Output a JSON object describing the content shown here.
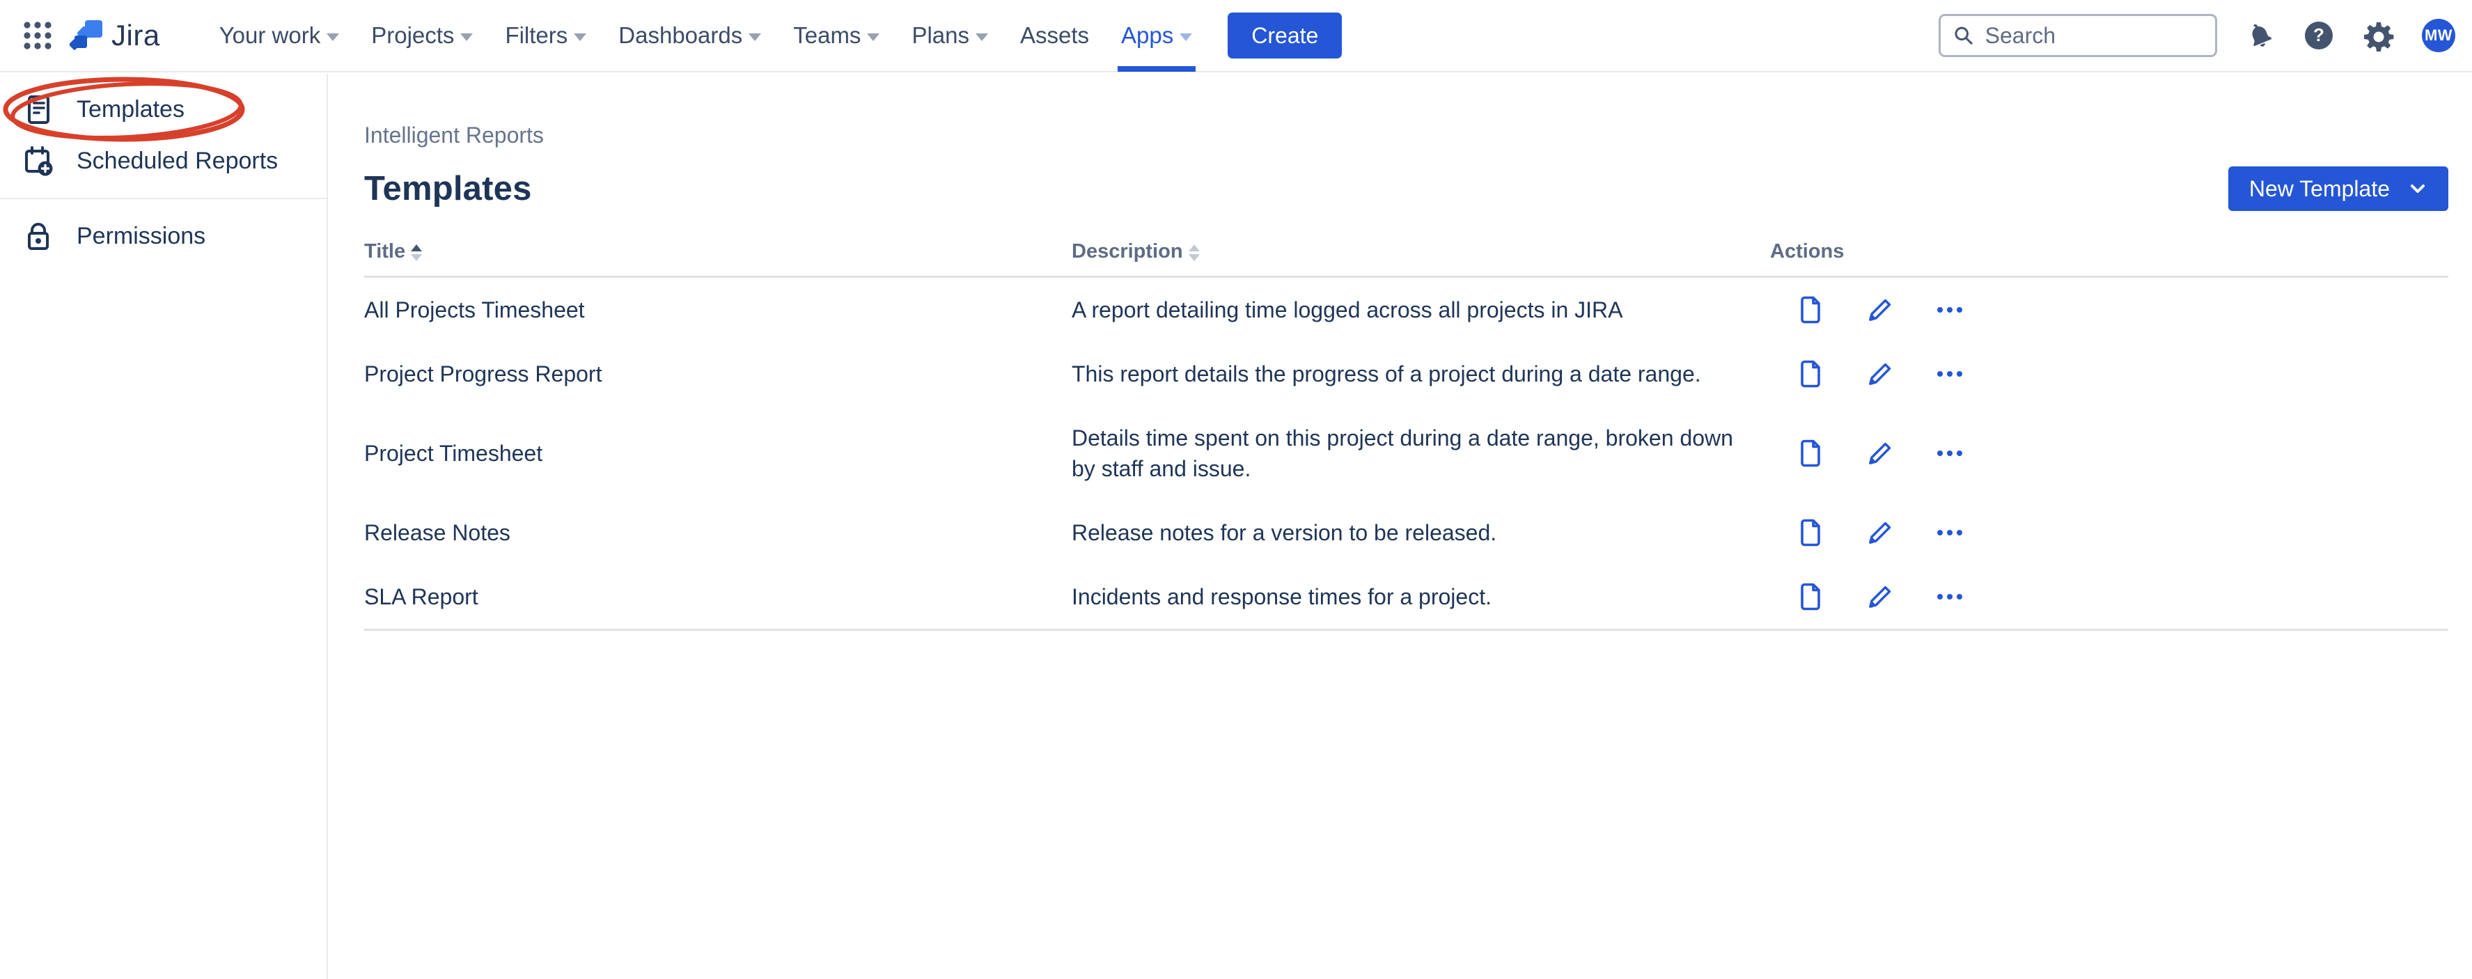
{
  "header": {
    "logo_text": "Jira",
    "nav_items": [
      {
        "label": "Your work",
        "chevron": true,
        "active": false
      },
      {
        "label": "Projects",
        "chevron": true,
        "active": false
      },
      {
        "label": "Filters",
        "chevron": true,
        "active": false
      },
      {
        "label": "Dashboards",
        "chevron": true,
        "active": false
      },
      {
        "label": "Teams",
        "chevron": true,
        "active": false
      },
      {
        "label": "Plans",
        "chevron": true,
        "active": false
      },
      {
        "label": "Assets",
        "chevron": false,
        "active": false
      },
      {
        "label": "Apps",
        "chevron": true,
        "active": true
      }
    ],
    "create_label": "Create",
    "search_placeholder": "Search",
    "avatar_initials": "MW"
  },
  "sidebar": {
    "items": [
      {
        "label": "Templates",
        "annotated": true
      },
      {
        "label": "Scheduled Reports"
      },
      {
        "label": "Permissions"
      }
    ]
  },
  "main": {
    "breadcrumb": "Intelligent Reports",
    "page_title": "Templates",
    "new_template_label": "New Template",
    "table": {
      "headers": {
        "title": "Title",
        "description": "Description",
        "actions": "Actions"
      },
      "sort": {
        "title": "ascending",
        "description": "none"
      },
      "row_action_icons": [
        "view-document-icon",
        "edit-pencil-icon",
        "more-ellipsis-icon"
      ],
      "rows": [
        {
          "title": "All Projects Timesheet",
          "description": "A report detailing time logged across all projects in JIRA"
        },
        {
          "title": "Project Progress Report",
          "description": "This report details the progress of a project during a date range."
        },
        {
          "title": "Project Timesheet",
          "description": "Details time spent on this project during a date range, broken down by staff and issue."
        },
        {
          "title": "Release Notes",
          "description": "Release notes for a version to be released."
        },
        {
          "title": "SLA Report",
          "description": "Incidents and response times for a project."
        }
      ]
    }
  },
  "colors": {
    "accent_blue": "#2456D6",
    "navy_text": "#1E3557",
    "header_gray": "#5E6C84",
    "slate_icon": "#44546E",
    "annotation_red": "#D7402B",
    "border_gray": "#DFE1E6"
  }
}
